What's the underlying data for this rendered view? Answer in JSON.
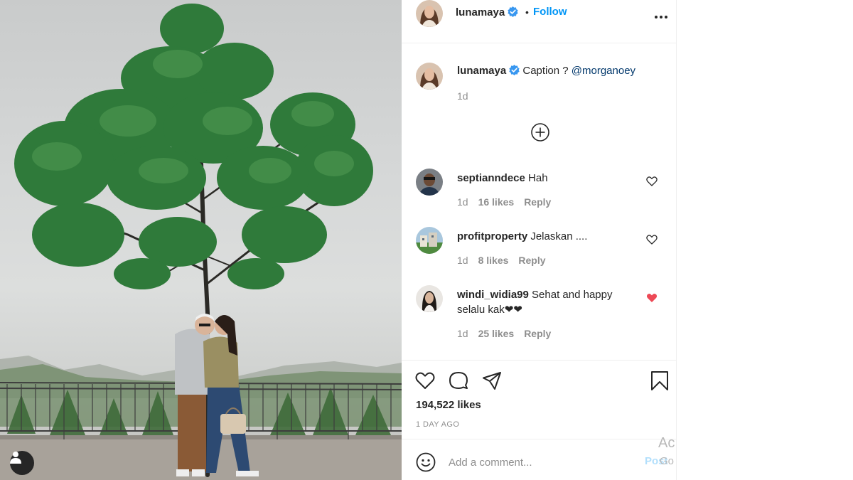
{
  "post": {
    "author": "lunamaya",
    "follow_label": "Follow",
    "separator": "•",
    "caption_text": "Caption ?",
    "caption_mention": "@morganoey",
    "caption_time": "1d",
    "likes": "194,522 likes",
    "posted_ago": "1 DAY AGO"
  },
  "comments": [
    {
      "user": "septianndece",
      "text": "Hah",
      "time": "1d",
      "likes": "16 likes",
      "reply": "Reply",
      "liked": false
    },
    {
      "user": "profitproperty",
      "text": "Jelaskan ....",
      "time": "1d",
      "likes": "8 likes",
      "reply": "Reply",
      "liked": false
    },
    {
      "user": "windi_widia99",
      "text": "Sehat and happy selalu kak❤❤",
      "time": "1d",
      "likes": "25 likes",
      "reply": "Reply",
      "liked": true
    }
  ],
  "add_comment": {
    "placeholder": "Add a comment...",
    "post_label": "Post"
  },
  "watermark": {
    "line1": "Ac",
    "line2": "Go"
  },
  "icons": {
    "more": "more-options-icon",
    "verified": "verified-badge-icon",
    "load_more": "load-more-comments-icon",
    "like": "heart-icon",
    "comment": "comment-icon",
    "share": "share-icon",
    "save": "bookmark-icon",
    "emoji": "emoji-icon",
    "user": "user-tag-icon"
  },
  "colors": {
    "accent": "#0095f6",
    "mention": "#00376b",
    "muted": "#8e8e8e",
    "liked_heart": "#ed4956",
    "post_disabled": "#b2dffc"
  }
}
